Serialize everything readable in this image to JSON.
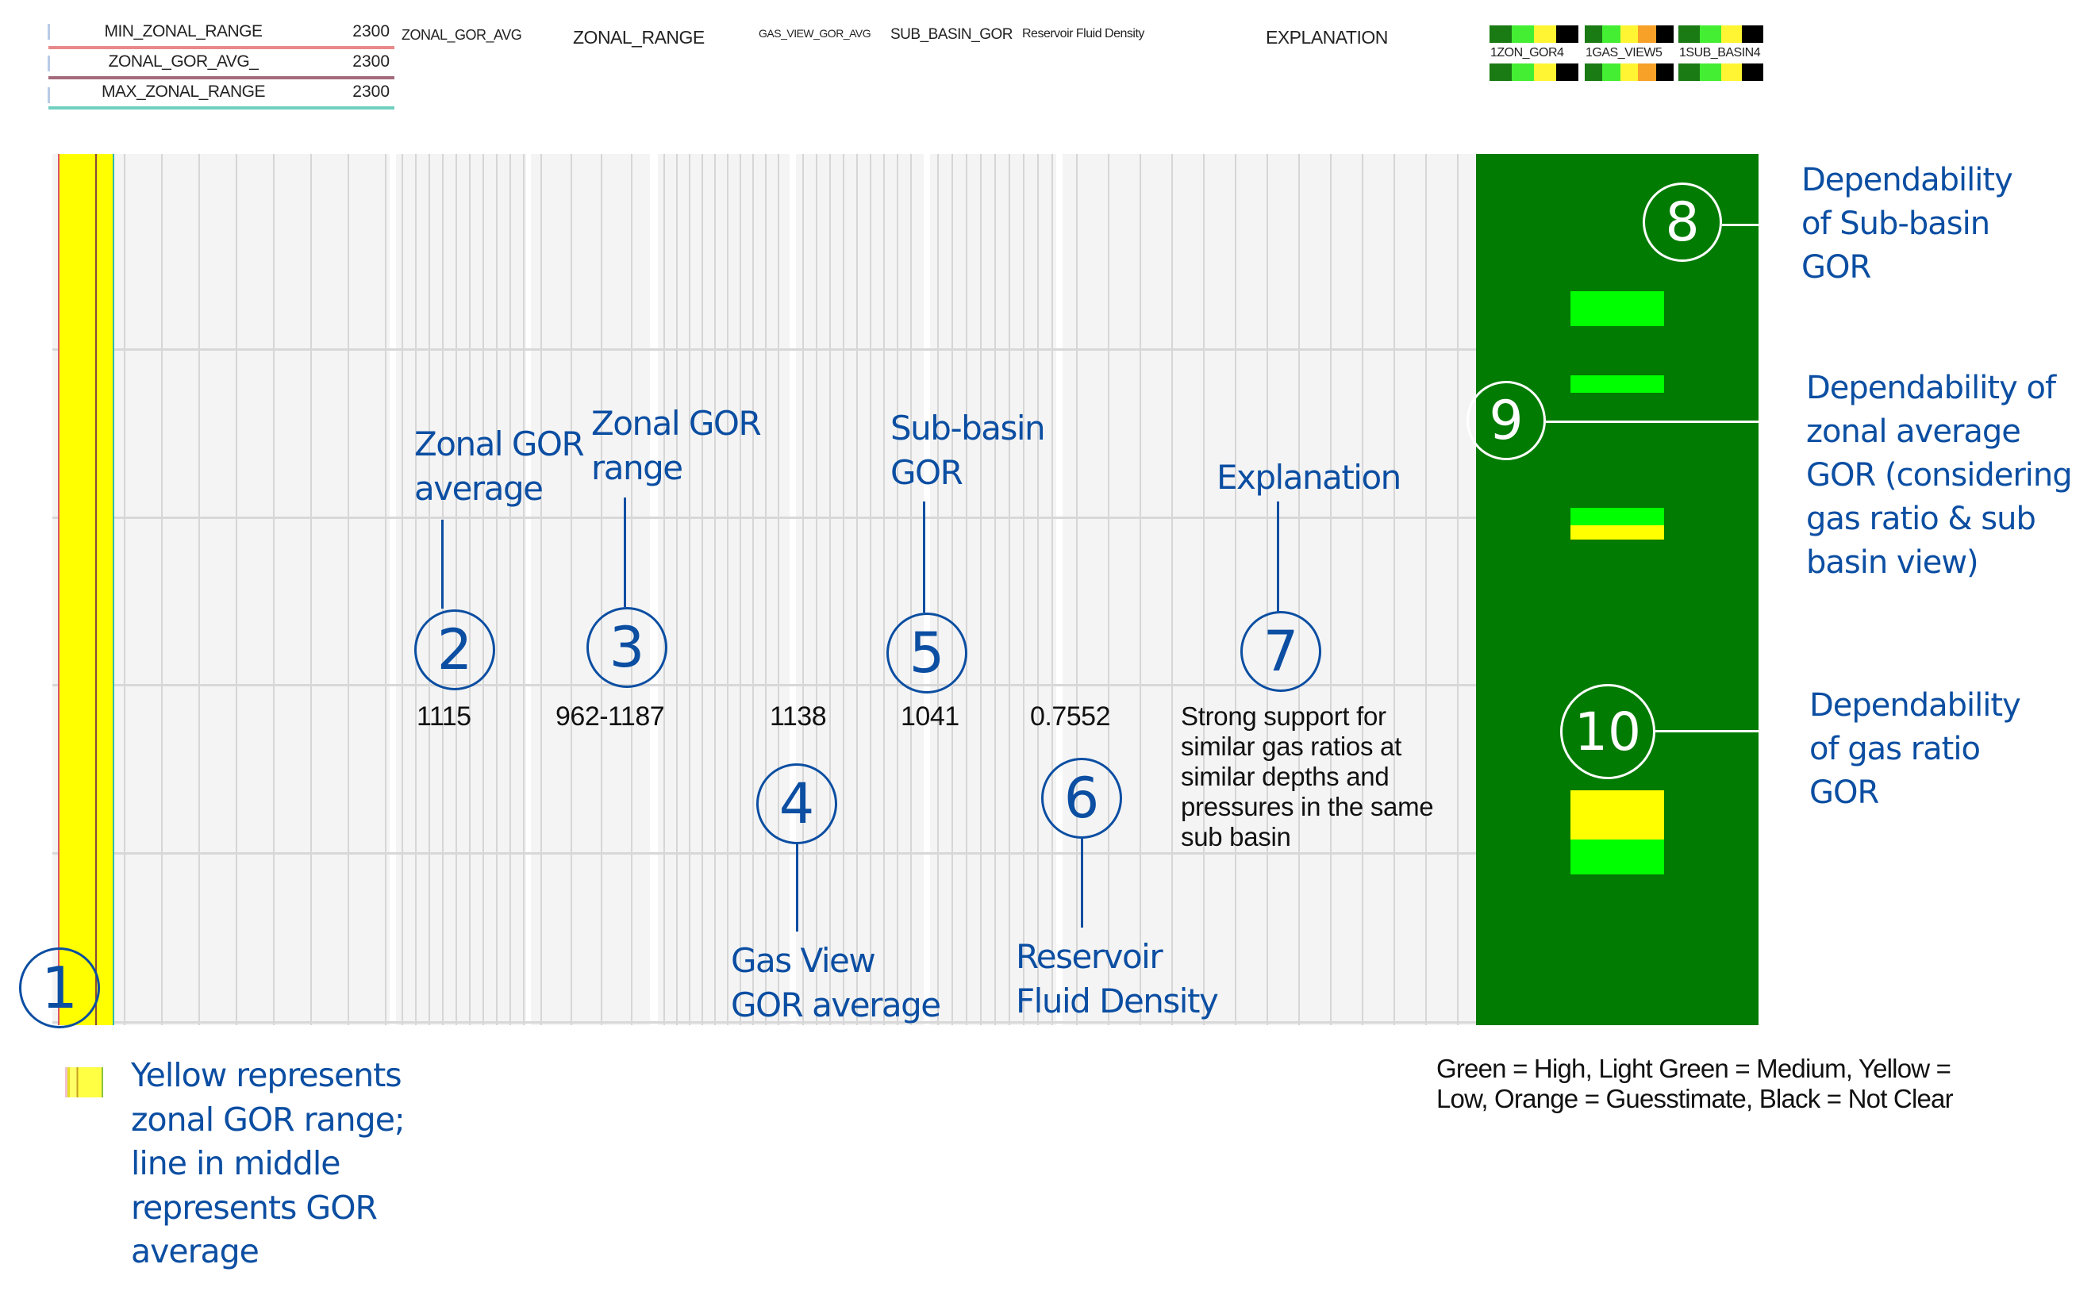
{
  "header_legend": {
    "rows": [
      {
        "name": "MIN_ZONAL_RANGE",
        "value": "2300",
        "color": "#e88a8a"
      },
      {
        "name": "ZONAL_GOR_AVG_",
        "value": "2300",
        "color": "#a36a7c"
      },
      {
        "name": "MAX_ZONAL_RANGE",
        "value": "2300",
        "color": "#6fcfbf"
      }
    ]
  },
  "track_headers": {
    "zonal_gor_avg": "ZONAL_GOR_AVG",
    "zonal_range": "ZONAL_RANGE",
    "gas_view_gor_avg": "GAS_VIEW_GOR_AVG",
    "sub_basin_gor": "SUB_BASIN_GOR",
    "reservoir_fluid_density": "Reservoir Fluid Density",
    "explanation": "EXPLANATION"
  },
  "color_scales": [
    {
      "min": "1",
      "label": "ZON_GOR",
      "max": "4",
      "colors": [
        "#1a7a14",
        "#44ee33",
        "#fff533",
        "#000000"
      ]
    },
    {
      "min": "1",
      "label": "GAS_VIEW",
      "max": "5",
      "colors": [
        "#1a7a14",
        "#44ee33",
        "#fff533",
        "#f7a128",
        "#000000"
      ]
    },
    {
      "min": "1",
      "label": "SUB_BASIN",
      "max": "4",
      "colors": [
        "#1a7a14",
        "#44ee33",
        "#fff533",
        "#000000"
      ]
    }
  ],
  "values": {
    "zonal_gor_avg": "1115",
    "zonal_range": "962-1187",
    "gas_view_gor_avg": "1138",
    "sub_basin_gor": "1041",
    "reservoir_fluid_density": "0.7552",
    "explanation": "Strong support for similar gas ratios at similar depths and pressures in the same sub basin"
  },
  "explanation_lines": [
    "Strong support for",
    "similar gas ratios at",
    "similar depths and",
    "pressures in the same",
    "sub basin"
  ],
  "callouts": [
    {
      "num": "1",
      "label_lines": []
    },
    {
      "num": "2",
      "label_lines": [
        "Zonal GOR",
        "average"
      ]
    },
    {
      "num": "3",
      "label_lines": [
        "Zonal GOR",
        "range"
      ]
    },
    {
      "num": "4",
      "label_lines": [
        "Gas View",
        "GOR average"
      ]
    },
    {
      "num": "5",
      "label_lines": [
        "Sub-basin",
        "GOR"
      ]
    },
    {
      "num": "6",
      "label_lines": [
        "Reservoir",
        "Fluid Density"
      ]
    },
    {
      "num": "7",
      "label_lines": [
        "Explanation"
      ]
    },
    {
      "num": "8",
      "label_lines": [
        "Dependability",
        "of Sub-basin",
        "GOR"
      ]
    },
    {
      "num": "9",
      "label_lines": [
        "Dependability of",
        "zonal average",
        "GOR (considering",
        "gas ratio & sub",
        "basin view)"
      ]
    },
    {
      "num": "10",
      "label_lines": [
        "Dependability",
        "of gas ratio",
        "GOR"
      ]
    }
  ],
  "dependability": {
    "sub_basin_gor": "Medium",
    "zonal_average_gor": [
      "Medium",
      "Low"
    ],
    "gas_ratio_gor": [
      "Low",
      "Medium"
    ],
    "panel_color": "#017b01",
    "medium_color": "#00ff00",
    "low_color": "#ffff00"
  },
  "yellow_note_lines": [
    "Yellow represents",
    "zonal GOR range;",
    "line in middle",
    "represents GOR",
    "average"
  ],
  "color_key_lines": [
    "Green = High, Light Green = Medium, Yellow =",
    "Low, Orange = Guesstimate, Black = Not Clear"
  ],
  "zonal_range_band_color": "#ffff00"
}
